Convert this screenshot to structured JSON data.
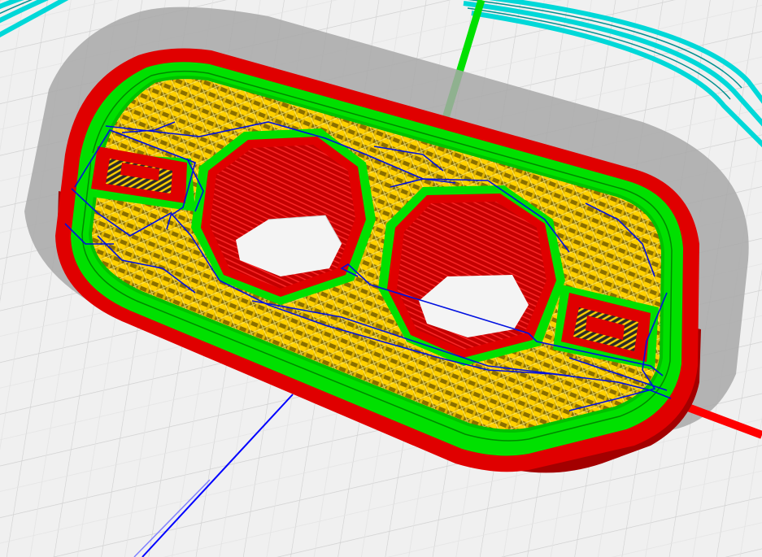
{
  "viewer": {
    "view": "3d-toolpath-preview",
    "colors": {
      "background": "#f0f0f0",
      "build_plate_grid": "#cfcfcf",
      "shadow": "#a8a8a8",
      "outer_wall": "#e00000",
      "outer_wall_side": "#a80000",
      "inner_wall": "#00e000",
      "infill": "#ffd000",
      "infill_dark": "#b89400",
      "travel_moves": "#0010e0",
      "skirt": "#00e0e0",
      "axis_x": "#ff0000",
      "axis_y": "#00e000",
      "axis_z": "#0000ff"
    },
    "model": {
      "shape": "rounded-rectangle-bracket",
      "holes": 4
    }
  }
}
